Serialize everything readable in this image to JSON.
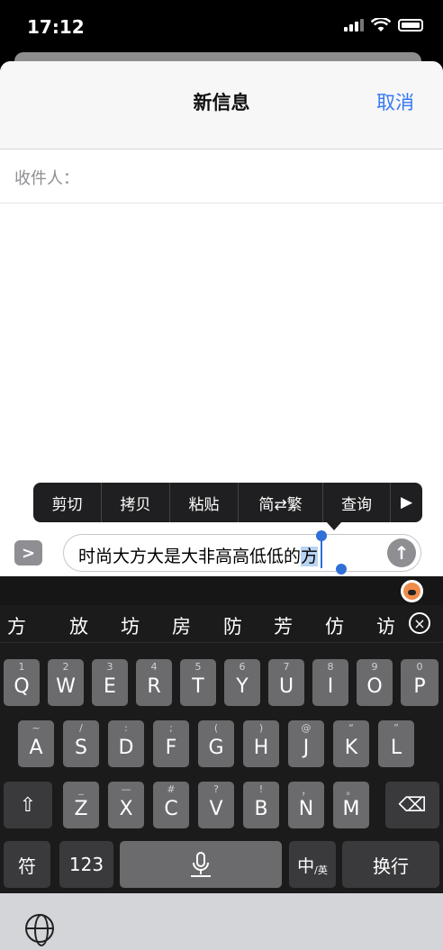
{
  "status": {
    "time": "17:12"
  },
  "nav": {
    "title": "新信息",
    "cancel": "取消"
  },
  "recipient": {
    "label": "收件人："
  },
  "edit_menu": {
    "items": [
      "剪切",
      "拷贝",
      "粘贴",
      "简⇄繁",
      "查询",
      "▶"
    ]
  },
  "message": {
    "text_prefix": "时尚大方大是大非高高低低的",
    "marked_text": "方"
  },
  "candidates": [
    "方",
    "放",
    "坊",
    "房",
    "防",
    "芳",
    "仿",
    "访"
  ],
  "keyboard": {
    "row1": [
      {
        "key": "Q",
        "hint": "1"
      },
      {
        "key": "W",
        "hint": "2"
      },
      {
        "key": "E",
        "hint": "3"
      },
      {
        "key": "R",
        "hint": "4"
      },
      {
        "key": "T",
        "hint": "5"
      },
      {
        "key": "Y",
        "hint": "6"
      },
      {
        "key": "U",
        "hint": "7"
      },
      {
        "key": "I",
        "hint": "8"
      },
      {
        "key": "O",
        "hint": "9"
      },
      {
        "key": "P",
        "hint": "0"
      }
    ],
    "row2": [
      {
        "key": "A",
        "hint": "~"
      },
      {
        "key": "S",
        "hint": "/"
      },
      {
        "key": "D",
        "hint": ":"
      },
      {
        "key": "F",
        "hint": ";"
      },
      {
        "key": "G",
        "hint": "("
      },
      {
        "key": "H",
        "hint": ")"
      },
      {
        "key": "J",
        "hint": "@"
      },
      {
        "key": "K",
        "hint": "“"
      },
      {
        "key": "L",
        "hint": "”"
      }
    ],
    "row3": [
      {
        "key": "Z",
        "hint": "_"
      },
      {
        "key": "X",
        "hint": "—"
      },
      {
        "key": "C",
        "hint": "#"
      },
      {
        "key": "V",
        "hint": "?"
      },
      {
        "key": "B",
        "hint": "!"
      },
      {
        "key": "N",
        "hint": "，"
      },
      {
        "key": "M",
        "hint": "。"
      }
    ],
    "symbols": "符",
    "numbers": "123",
    "lang_main": "中",
    "lang_sub": "/英",
    "return": "换行"
  }
}
